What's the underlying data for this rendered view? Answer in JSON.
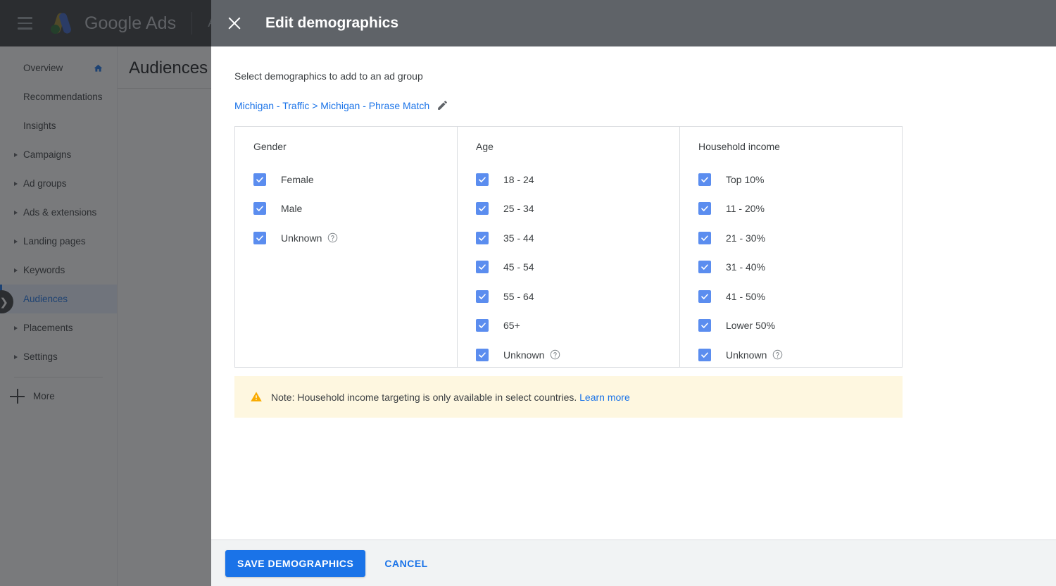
{
  "topbar": {
    "menu_icon": "hamburger-icon",
    "logo_icon": "google-ads-logo",
    "brand": "Google Ads",
    "account_label": "All"
  },
  "sidebar": {
    "items": [
      {
        "label": "Overview",
        "expandable": false,
        "has_home_icon": true,
        "selected": false
      },
      {
        "label": "Recommendations",
        "expandable": false,
        "has_home_icon": false,
        "selected": false
      },
      {
        "label": "Insights",
        "expandable": false,
        "has_home_icon": false,
        "selected": false
      },
      {
        "label": "Campaigns",
        "expandable": true,
        "has_home_icon": false,
        "selected": false
      },
      {
        "label": "Ad groups",
        "expandable": true,
        "has_home_icon": false,
        "selected": false
      },
      {
        "label": "Ads & extensions",
        "expandable": true,
        "has_home_icon": false,
        "selected": false
      },
      {
        "label": "Landing pages",
        "expandable": true,
        "has_home_icon": false,
        "selected": false
      },
      {
        "label": "Keywords",
        "expandable": true,
        "has_home_icon": false,
        "selected": false
      },
      {
        "label": "Audiences",
        "expandable": false,
        "has_home_icon": false,
        "selected": true
      },
      {
        "label": "Placements",
        "expandable": true,
        "has_home_icon": false,
        "selected": false
      },
      {
        "label": "Settings",
        "expandable": true,
        "has_home_icon": false,
        "selected": false
      }
    ],
    "more_label": "More",
    "expand_handle_icon": "chevron-right-icon"
  },
  "page": {
    "title": "Audiences"
  },
  "modal": {
    "close_icon": "close-icon",
    "title": "Edit demographics",
    "subtitle": "Select demographics to add to an ad group",
    "breadcrumb": "Michigan - Traffic > Michigan - Phrase Match",
    "edit_icon": "pencil-icon",
    "columns": [
      {
        "title": "Gender",
        "options": [
          {
            "label": "Female",
            "checked": true,
            "help": false
          },
          {
            "label": "Male",
            "checked": true,
            "help": false
          },
          {
            "label": "Unknown",
            "checked": true,
            "help": true
          }
        ]
      },
      {
        "title": "Age",
        "options": [
          {
            "label": "18 - 24",
            "checked": true,
            "help": false
          },
          {
            "label": "25 - 34",
            "checked": true,
            "help": false
          },
          {
            "label": "35 - 44",
            "checked": true,
            "help": false
          },
          {
            "label": "45 - 54",
            "checked": true,
            "help": false
          },
          {
            "label": "55 - 64",
            "checked": true,
            "help": false
          },
          {
            "label": "65+",
            "checked": true,
            "help": false
          },
          {
            "label": "Unknown",
            "checked": true,
            "help": true
          }
        ]
      },
      {
        "title": "Household income",
        "options": [
          {
            "label": "Top 10%",
            "checked": true,
            "help": false
          },
          {
            "label": "11 - 20%",
            "checked": true,
            "help": false
          },
          {
            "label": "21 - 30%",
            "checked": true,
            "help": false
          },
          {
            "label": "31 - 40%",
            "checked": true,
            "help": false
          },
          {
            "label": "41 - 50%",
            "checked": true,
            "help": false
          },
          {
            "label": "Lower 50%",
            "checked": true,
            "help": false
          },
          {
            "label": "Unknown",
            "checked": true,
            "help": true
          }
        ]
      }
    ],
    "note": {
      "icon": "warning-triangle-icon",
      "text": "Note: Household income targeting is only available in select countries.",
      "link": "Learn more"
    },
    "footer": {
      "save_label": "SAVE DEMOGRAPHICS",
      "cancel_label": "CANCEL"
    }
  },
  "colors": {
    "accent": "#1a73e8",
    "checkbox": "#5b8def",
    "topbar": "#3c4043",
    "modal_header": "#5f6368",
    "note_bg": "#fef7e0",
    "warning": "#f9ab00"
  }
}
